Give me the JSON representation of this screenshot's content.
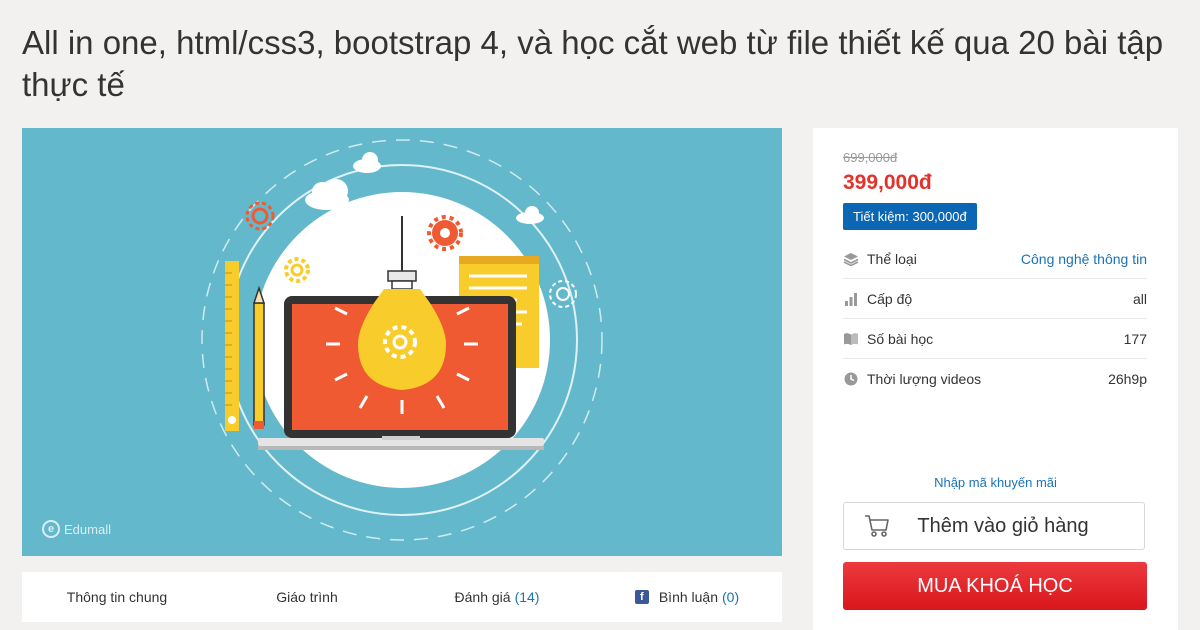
{
  "page_title": "All in one, html/css3, bootstrap 4, và học cắt web từ file thiết kế qua 20 bài tập thực tế",
  "hero": {
    "brand": "Edumall",
    "colors": {
      "background": "#63b9cb",
      "screen": "#f05a33",
      "bulb": "#f8cc2b"
    }
  },
  "tabs": [
    {
      "label": "Thông tin chung"
    },
    {
      "label": "Giáo trình"
    },
    {
      "label": "Đánh giá",
      "count": "(14)"
    },
    {
      "label": "Bình luận",
      "count": "(0)",
      "icon": "facebook-icon"
    }
  ],
  "pricing": {
    "original": "699,000đ",
    "current": "399,000đ",
    "saving": "Tiết kiệm: 300,000đ",
    "colors": {
      "price": "#e4312a",
      "badge": "#0b66b3",
      "buy": "#e32128"
    }
  },
  "details": [
    {
      "icon": "layers-icon",
      "label": "Thể loại",
      "value": "Công nghệ thông tin",
      "is_link": true
    },
    {
      "icon": "bar-chart-icon",
      "label": "Cấp độ",
      "value": "all",
      "is_link": false
    },
    {
      "icon": "book-icon",
      "label": "Số bài học",
      "value": "177",
      "is_link": false
    },
    {
      "icon": "clock-icon",
      "label": "Thời lượng videos",
      "value": "26h9p",
      "is_link": false
    }
  ],
  "promo_link": "Nhập mã khuyến mãi",
  "cart_button": "Thêm vào giỏ hàng",
  "buy_button": "MUA KHOÁ HỌC"
}
